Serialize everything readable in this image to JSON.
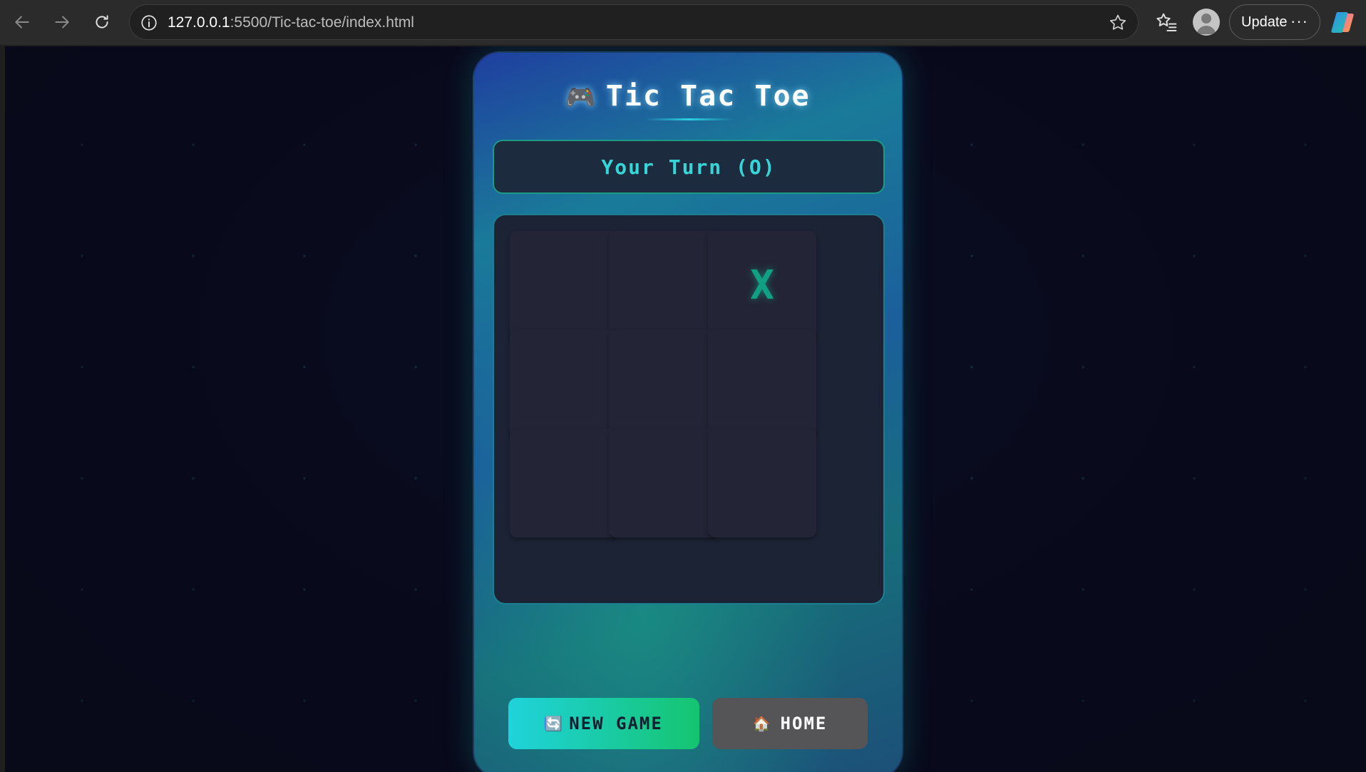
{
  "browser": {
    "url_host": "127.0.0.1",
    "url_path": ":5500/Tic-tac-toe/index.html",
    "update_label": "Update",
    "more_label": "···"
  },
  "game": {
    "icon": "🎮",
    "title": "Tic Tac Toe",
    "status": "Your Turn (O)",
    "board": [
      "",
      "",
      "X",
      "",
      "",
      "",
      "",
      "",
      ""
    ]
  },
  "buttons": {
    "new_game_icon": "🔄",
    "new_game_label": "NEW GAME",
    "home_icon": "🏠",
    "home_label": "HOME"
  },
  "colors": {
    "accent": "#36d6d8",
    "mark_x": "#11a084",
    "new_game_gradient": [
      "#1fd3dc",
      "#15c46f"
    ],
    "home_button": "#555558"
  }
}
